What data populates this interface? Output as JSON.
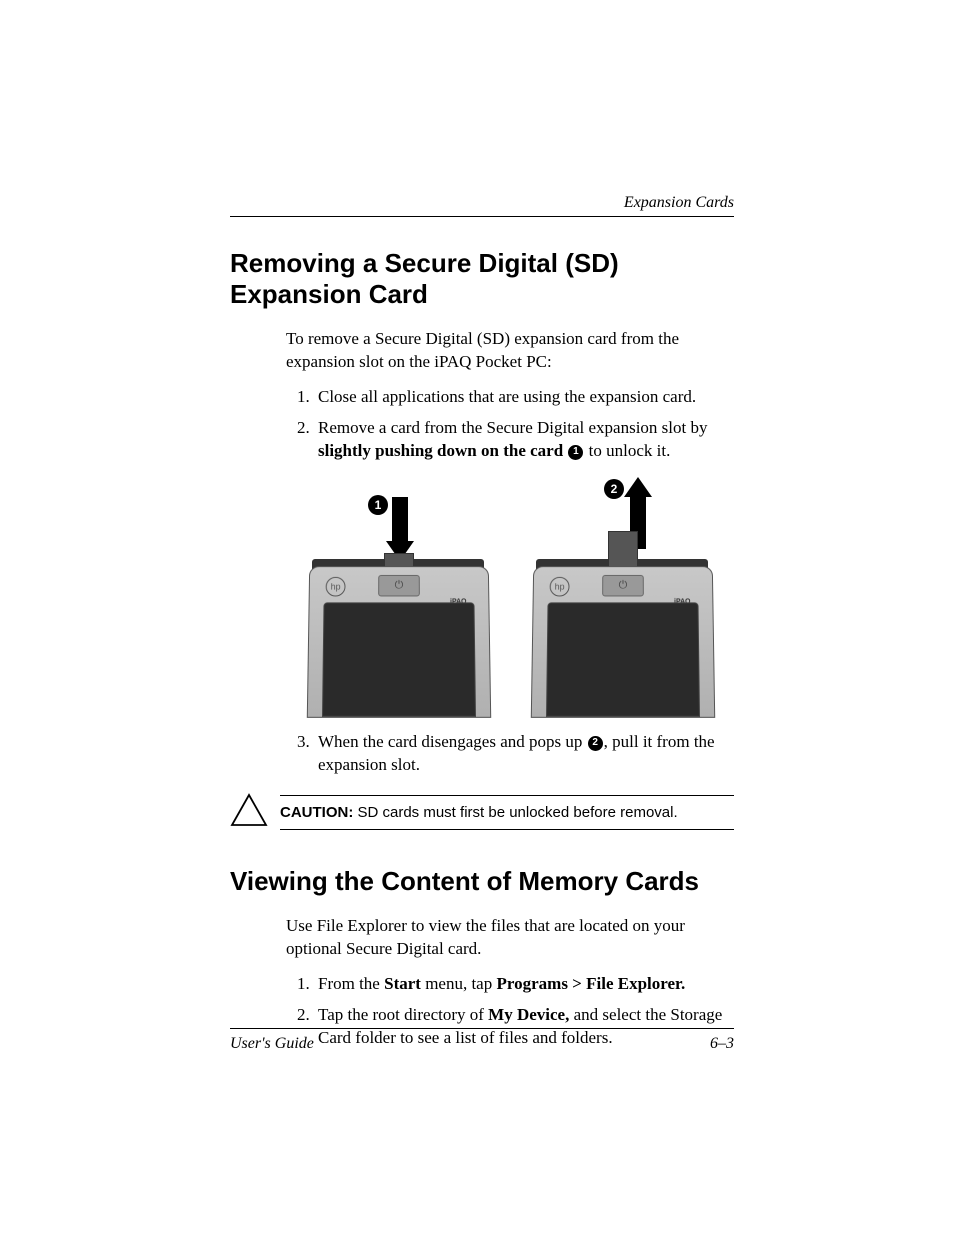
{
  "header": {
    "chapter": "Expansion Cards"
  },
  "section1": {
    "heading": "Removing a Secure Digital (SD) Expansion Card",
    "intro": "To remove a Secure Digital (SD) expansion card from the expansion slot on the iPAQ Pocket PC:",
    "step1": "Close all applications that are using the expansion card.",
    "step2_a": "Remove a card from the Secure Digital expansion slot by ",
    "step2_bold": "slightly pushing down on the card",
    "step2_b": " to unlock it.",
    "callout1": "1",
    "callout2": "2",
    "device_label": "iPAQ",
    "step3_a": "When the card disengages and pops up ",
    "step3_b": ", pull it from the expansion slot."
  },
  "caution": {
    "label": "CAUTION:",
    "text": " SD cards must first be unlocked before removal."
  },
  "section2": {
    "heading": "Viewing the Content of Memory Cards",
    "intro": "Use File Explorer to view the files that are located on your optional Secure Digital card.",
    "step1_a": "From the ",
    "step1_b1": "Start",
    "step1_c": " menu, tap ",
    "step1_b2": "Programs > File Explorer.",
    "step2_a": "Tap the root directory of ",
    "step2_b": "My Device,",
    "step2_c": " and select the Storage Card folder to see a list of files and folders."
  },
  "footer": {
    "left": "User's Guide",
    "right": "6–3"
  }
}
